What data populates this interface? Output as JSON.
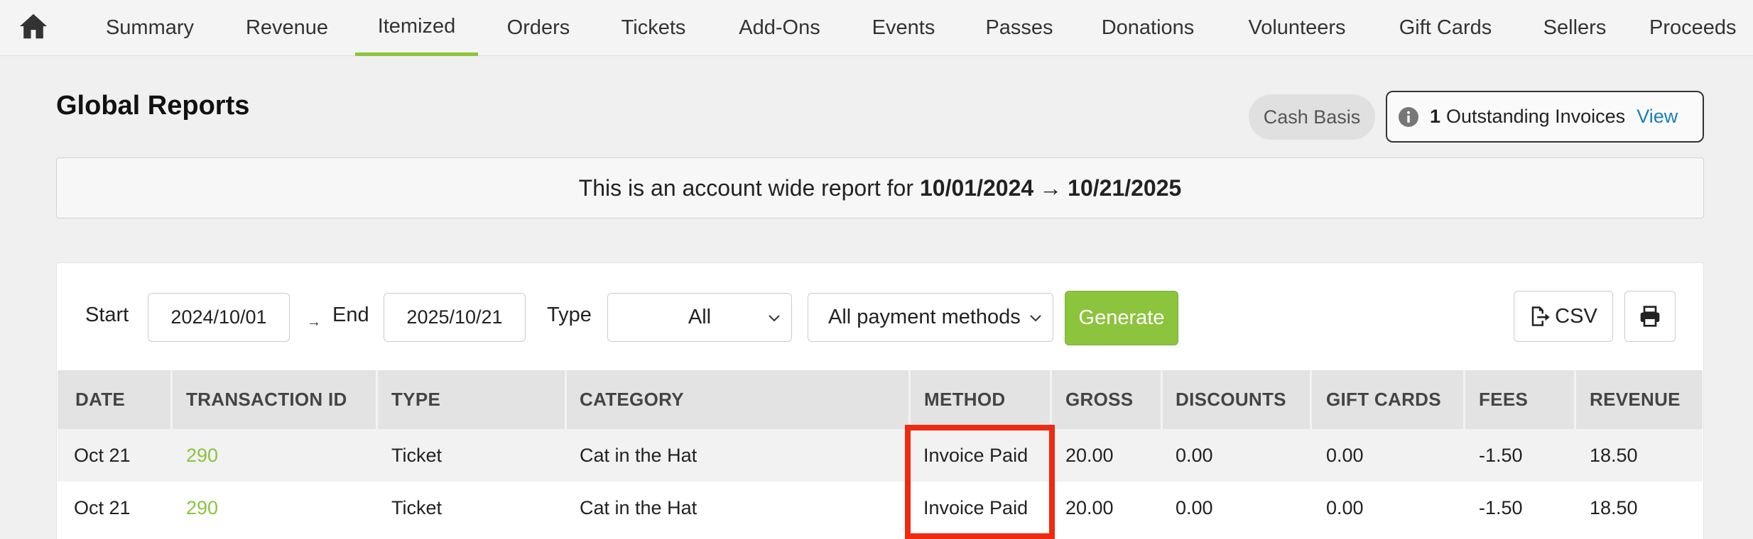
{
  "nav": {
    "home_icon": "home-icon",
    "items": [
      "Summary",
      "Revenue",
      "Itemized",
      "Orders",
      "Tickets",
      "Add-Ons",
      "Events",
      "Passes",
      "Donations",
      "Volunteers",
      "Gift Cards",
      "Sellers",
      "Proceeds"
    ],
    "active": "Itemized"
  },
  "header": {
    "title": "Global Reports",
    "basis": "Cash Basis",
    "invoices": {
      "icon": "info-icon",
      "count": "1",
      "text": "Outstanding Invoices",
      "link": "View"
    }
  },
  "banner": {
    "prefix": "This is an account wide report for",
    "start": "10/01/2024",
    "arrow": "→",
    "end": "10/21/2025"
  },
  "filters": {
    "start_label": "Start",
    "start_value": "2024/10/01",
    "range_arrow": "→",
    "end_label": "End",
    "end_value": "2025/10/21",
    "type_label": "Type",
    "type_value": "All",
    "method_value": "All payment methods",
    "generate": "Generate",
    "csv": "CSV",
    "csv_icon": "file-export-icon",
    "print_icon": "print-icon"
  },
  "table": {
    "columns": [
      "DATE",
      "TRANSACTION ID",
      "TYPE",
      "CATEGORY",
      "METHOD",
      "GROSS",
      "DISCOUNTS",
      "GIFT CARDS",
      "FEES",
      "REVENUE"
    ],
    "rows": [
      [
        "Oct 21",
        "290",
        "Ticket",
        "Cat in the Hat",
        "Invoice Paid",
        "20.00",
        "0.00",
        "0.00",
        "-1.50",
        "18.50"
      ],
      [
        "Oct 21",
        "290",
        "Ticket",
        "Cat in the Hat",
        "Invoice Paid",
        "20.00",
        "0.00",
        "0.00",
        "-1.50",
        "18.50"
      ]
    ]
  },
  "colors": {
    "accent": "#8cc43e",
    "link": "#1a7fb6",
    "highlight": "#ee2a11"
  }
}
